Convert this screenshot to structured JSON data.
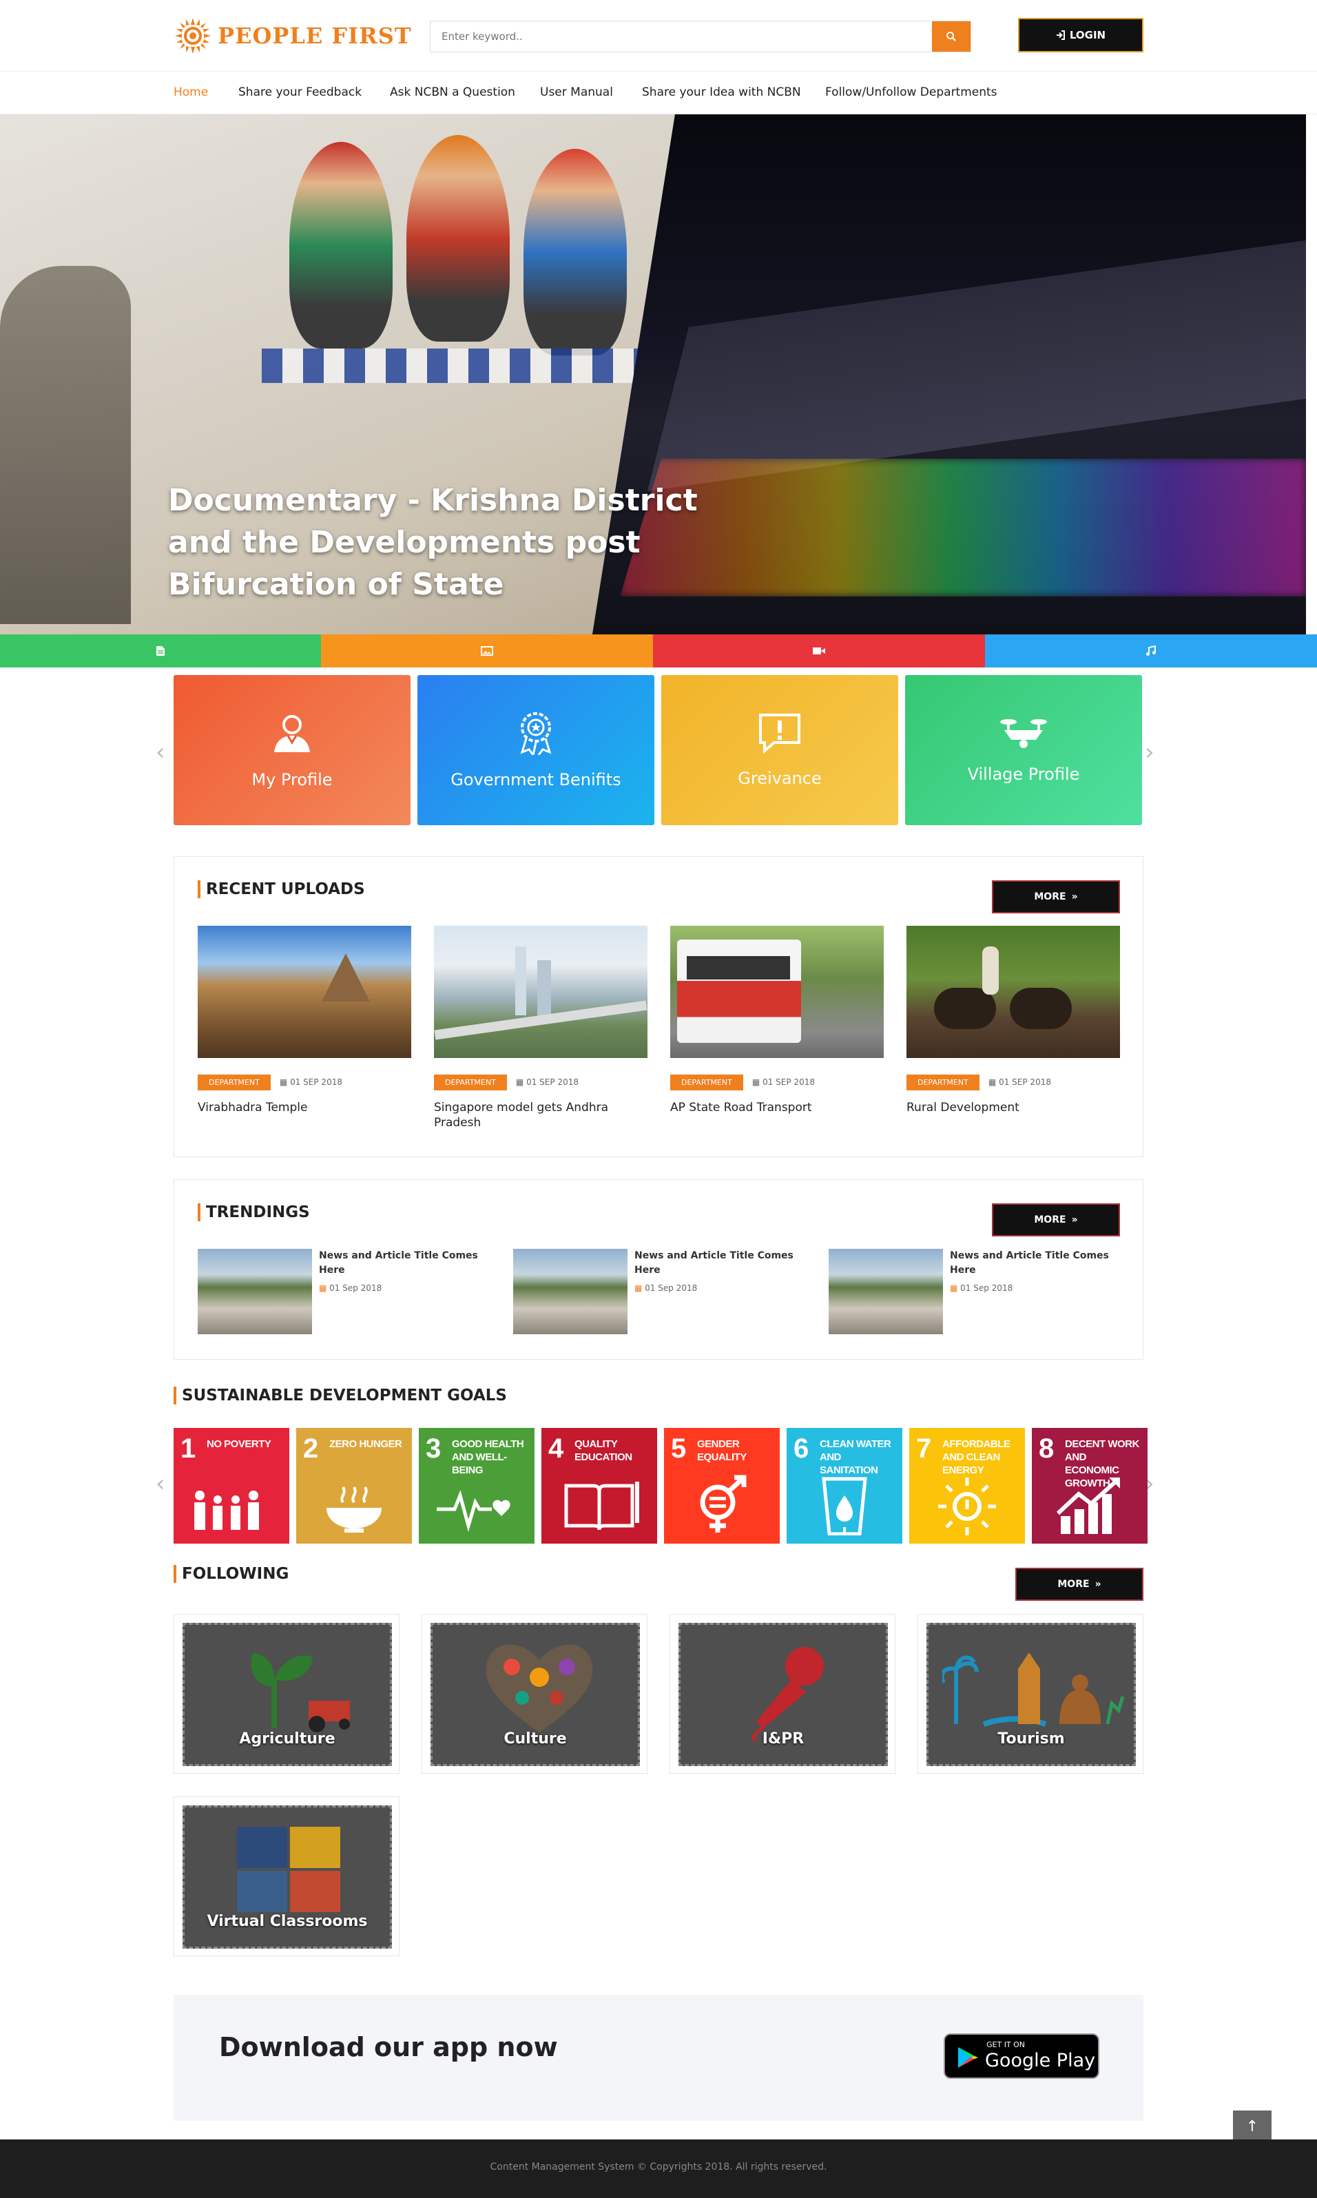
{
  "header": {
    "logo_text": "PEOPLE FIRST",
    "search_placeholder": "Enter keyword..",
    "login_label": "LOGIN"
  },
  "nav": {
    "items": [
      {
        "label": "Home",
        "active": true
      },
      {
        "label": "Share your Feedback"
      },
      {
        "label": "Ask NCBN a Question"
      },
      {
        "label": "User Manual"
      },
      {
        "label": "Share your Idea with NCBN"
      },
      {
        "label": "Follow/Unfollow Departments"
      }
    ]
  },
  "hero": {
    "title": "Documentary - Krishna District and the Developments post Bifurcation of State"
  },
  "media_tabs": [
    {
      "icon": "document-icon",
      "color": "#3ac564"
    },
    {
      "icon": "image-icon",
      "color": "#f7941d"
    },
    {
      "icon": "video-icon",
      "color": "#e8343b"
    },
    {
      "icon": "music-icon",
      "color": "#2ba6f2"
    }
  ],
  "quick_cards": [
    {
      "label": "My Profile",
      "icon": "user-icon"
    },
    {
      "label": "Government Benifits",
      "icon": "award-icon"
    },
    {
      "label": "Greivance",
      "icon": "alert-message-icon"
    },
    {
      "label": "Village Profile",
      "icon": "drone-icon"
    }
  ],
  "recent_uploads": {
    "title": "RECENT UPLOADS",
    "more_label": "MORE",
    "items": [
      {
        "badge": "DEPARTMENT",
        "date": "01 SEP 2018",
        "title": "Virabhadra Temple"
      },
      {
        "badge": "DEPARTMENT",
        "date": "01 SEP 2018",
        "title": "Singapore model gets Andhra Pradesh"
      },
      {
        "badge": "DEPARTMENT",
        "date": "01 SEP 2018",
        "title": "AP State Road Transport"
      },
      {
        "badge": "DEPARTMENT",
        "date": "01 SEP 2018",
        "title": "Rural Development"
      }
    ]
  },
  "trendings": {
    "title": "TRENDINGS",
    "more_label": "MORE",
    "items": [
      {
        "title": "News and Article Title Comes Here",
        "date": "01 Sep 2018"
      },
      {
        "title": "News and Article Title Comes Here",
        "date": "01 Sep 2018"
      },
      {
        "title": "News and Article Title Comes Here",
        "date": "01 Sep 2018"
      }
    ]
  },
  "sdg": {
    "title": "SUSTAINABLE DEVELOPMENT GOALS",
    "goals": [
      {
        "num": "1",
        "label": "NO POVERTY",
        "color": "#e5243b"
      },
      {
        "num": "2",
        "label": "ZERO HUNGER",
        "color": "#dda63a"
      },
      {
        "num": "3",
        "label": "GOOD HEALTH AND WELL-BEING",
        "color": "#4c9f38"
      },
      {
        "num": "4",
        "label": "QUALITY EDUCATION",
        "color": "#c5192d"
      },
      {
        "num": "5",
        "label": "GENDER EQUALITY",
        "color": "#ff3a21"
      },
      {
        "num": "6",
        "label": "CLEAN WATER AND SANITATION",
        "color": "#26bde2"
      },
      {
        "num": "7",
        "label": "AFFORDABLE AND CLEAN ENERGY",
        "color": "#fcc30b"
      },
      {
        "num": "8",
        "label": "DECENT WORK AND ECONOMIC GROWTH",
        "color": "#a21942"
      }
    ]
  },
  "following": {
    "title": "FOLLOWING",
    "more_label": "MORE",
    "items": [
      {
        "label": "Agriculture"
      },
      {
        "label": "Culture"
      },
      {
        "label": "I&PR"
      },
      {
        "label": "Tourism"
      },
      {
        "label": "Virtual Classrooms"
      }
    ]
  },
  "app": {
    "title": "Download our app now",
    "store_small": "GET IT ON",
    "store_big": "Google Play"
  },
  "footer": {
    "text": "Content Management System © Copyrights 2018. All rights reserved."
  },
  "colors": {
    "accent": "#f07f1e",
    "dark": "#111111"
  }
}
